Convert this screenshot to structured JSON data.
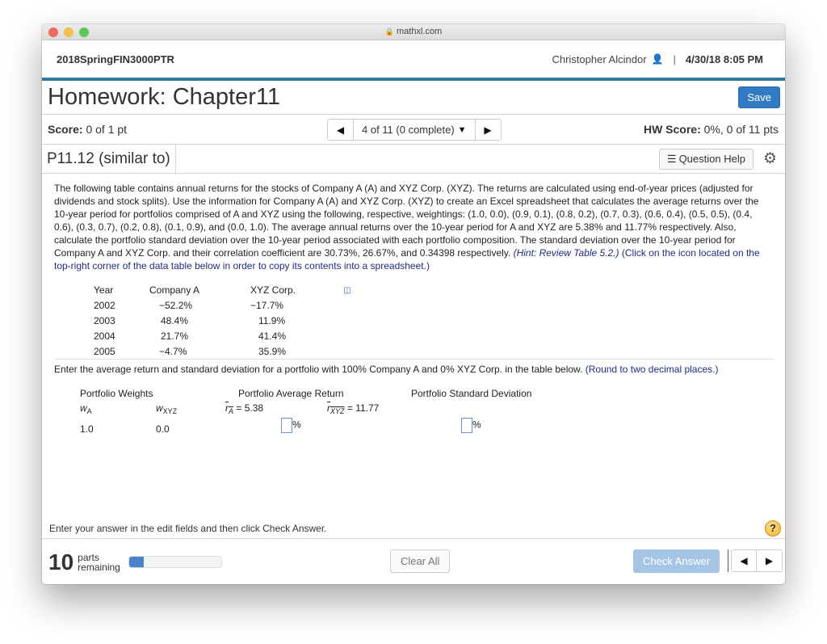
{
  "browser": {
    "url": "mathxl.com",
    "lock_icon": "lock-icon"
  },
  "header": {
    "course": "2018SpringFIN3000PTR",
    "user_name": "Christopher Alcindor",
    "user_icon": "person-icon",
    "separator": "|",
    "datetime": "4/30/18 8:05 PM"
  },
  "title_row": {
    "title": "Homework: Chapter11",
    "save_label": "Save"
  },
  "score_row": {
    "score_label": "Score:",
    "score_value": " 0 of 1 pt",
    "question_selector": "4 of 11 (0 complete)",
    "hw_score_label": "HW Score:",
    "hw_score_value": " 0%, 0 of 11 pts"
  },
  "problem": {
    "id": "P11.12 (similar to)",
    "help_label": "Question Help"
  },
  "question": {
    "text": "The following table contains annual returns for the stocks of Company A (A) and XYZ Corp. (XYZ). The returns are calculated using end-of-year prices (adjusted for dividends and stock splits). Use the information for Company A (A) and XYZ Corp. (XYZ) to create an Excel spreadsheet that calculates the average returns over the 10-year period for portfolios comprised of A and XYZ using the following, respective, weightings: (1.0, 0.0), (0.9, 0.1), (0.8, 0.2), (0.7, 0.3), (0.6, 0.4), (0.5, 0.5), (0.4, 0.6), (0.3, 0.7), (0.2, 0.8), (0.1, 0.9), and (0.0, 1.0). The average annual returns over the 10-year period for A and XYZ are 5.38% and 11.77% respectively. Also, calculate the portfolio standard deviation over the 10-year period associated with each portfolio composition. The standard deviation over the 10-year period for Company A and XYZ Corp. and their correlation coefficient are 30.73%, 26.67%, and 0.34398 respectively. ",
    "hint": "(Hint: Review Table 5.2.)",
    "click_note": " (Click on the icon located on the top-right corner of the data table below in order to copy its contents into a spreadsheet.)"
  },
  "returns_table": {
    "headers": [
      "Year",
      "Company A",
      "XYZ Corp."
    ],
    "rows": [
      [
        "2002",
        "−52.2%",
        "−17.7%"
      ],
      [
        "2003",
        "48.4%",
        "11.9%"
      ],
      [
        "2004",
        "21.7%",
        "41.4%"
      ],
      [
        "2005",
        "−4.7%",
        "35.9%"
      ]
    ]
  },
  "instruction": {
    "text": "Enter the average return and standard deviation for a portfolio with 100% Company A and 0% XYZ Corp. in the table below. ",
    "round_note": " (Round to two decimal places.)"
  },
  "portfolio": {
    "weights_header": "Portfolio Weights",
    "avg_return_header": "Portfolio Average Return",
    "std_dev_header": "Portfolio Standard Deviation",
    "w_symbol": "w",
    "wa_sub": "A",
    "wxyz_sub": "XYZ",
    "r_symbol": "r",
    "ra_sub": "A",
    "ra_value": " = 5.38",
    "rxyz_sub": "XYZ",
    "rxyz_value": " = 11.77",
    "wa_value": "1.0",
    "wxyz_value": "0.0",
    "avg_return_input": "",
    "std_dev_input": "",
    "percent": "%"
  },
  "footer": {
    "note": "Enter your answer in the edit fields and then click Check Answer.",
    "help_symbol": "?",
    "parts_count": "10",
    "parts_line1": "parts",
    "parts_line2": "remaining",
    "progress_fraction": 0.16,
    "clear_all": "Clear All",
    "check_answer": "Check Answer"
  },
  "colors": {
    "accent_bar": "#2f7999",
    "save_button": "#337ac5",
    "check_answer_disabled": "#a6c4e3",
    "progress_fill": "#4a83c8",
    "hint_text": "#1f2b83"
  }
}
